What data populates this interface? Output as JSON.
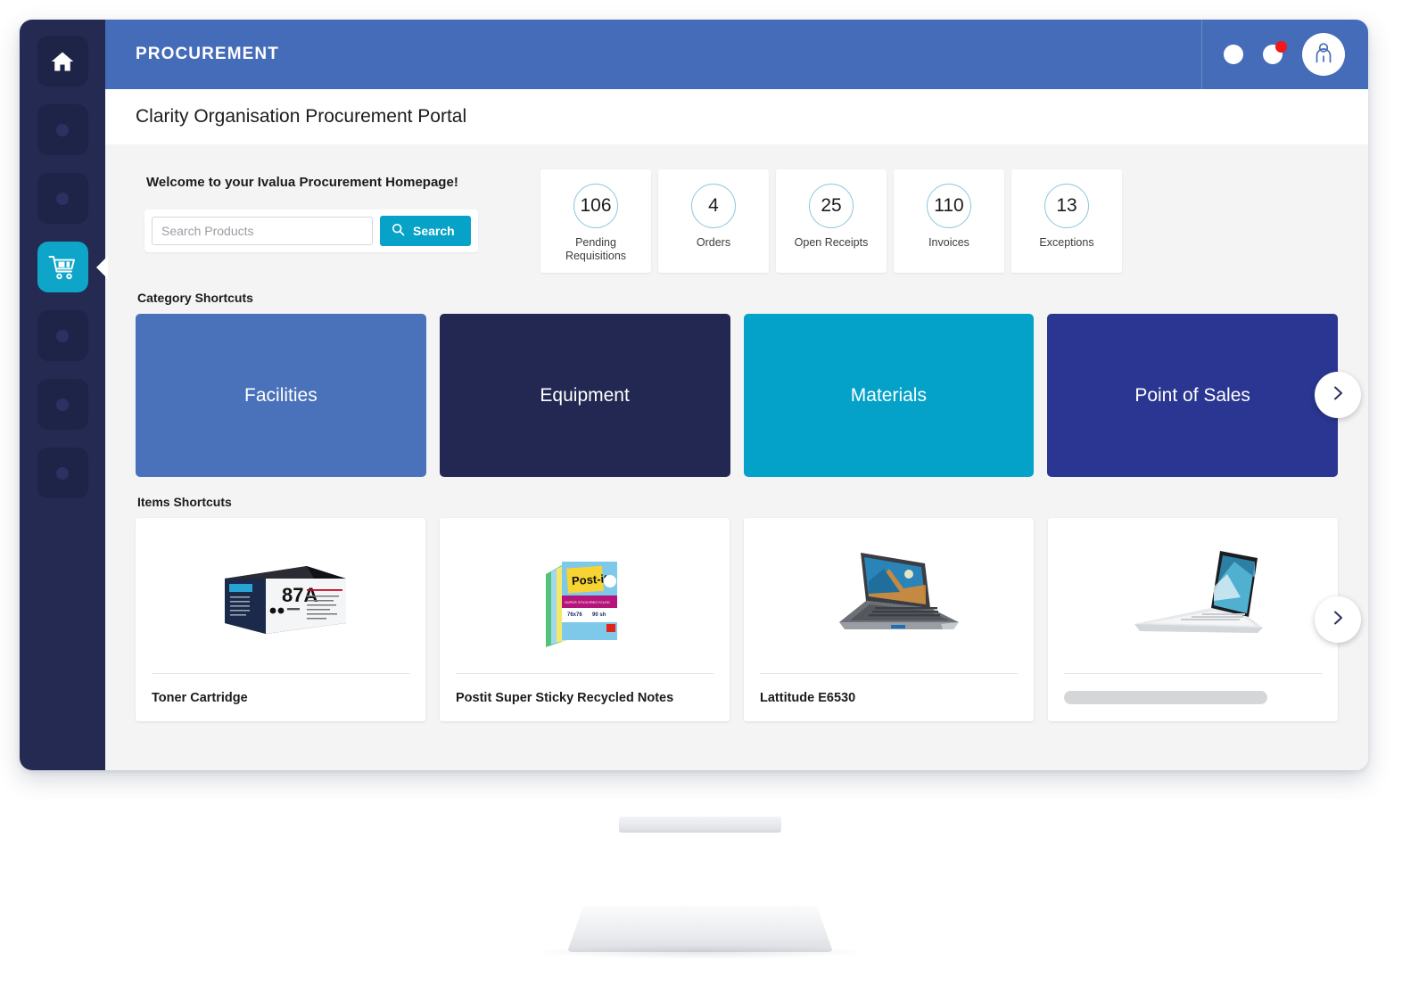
{
  "app": {
    "topbar_title": "PROCUREMENT",
    "page_title": "Clarity Organisation Procurement Portal",
    "header_color": "#456cb8",
    "sidebar_color": "#242a51",
    "accent_color": "#07a2c8",
    "badge_color": "#f01818"
  },
  "sidebar": {
    "items": [
      {
        "name": "home",
        "icon": "home-icon",
        "active": false
      },
      {
        "name": "nav-2",
        "icon": "dot-icon",
        "active": false
      },
      {
        "name": "nav-3",
        "icon": "dot-icon",
        "active": false
      },
      {
        "name": "shopping-cart",
        "icon": "cart-icon",
        "active": true
      },
      {
        "name": "nav-5",
        "icon": "dot-icon",
        "active": false
      },
      {
        "name": "nav-6",
        "icon": "dot-icon",
        "active": false
      },
      {
        "name": "nav-7",
        "icon": "dot-icon",
        "active": false
      }
    ]
  },
  "topbar": {
    "icons": [
      "circle-icon",
      "notification-icon"
    ],
    "avatar": "user-avatar-icon"
  },
  "welcome": {
    "heading": "Welcome to your Ivalua Procurement Homepage!"
  },
  "search": {
    "placeholder": "Search Products",
    "value": "",
    "button_label": "Search",
    "button_icon": "search-icon"
  },
  "kpis": [
    {
      "value": "106",
      "label": "Pending Requisitions"
    },
    {
      "value": "4",
      "label": "Orders"
    },
    {
      "value": "25",
      "label": "Open Receipts"
    },
    {
      "value": "110",
      "label": "Invoices"
    },
    {
      "value": "13",
      "label": "Exceptions"
    }
  ],
  "categories": {
    "title": "Category Shortcuts",
    "next_icon": "chevron-right-icon",
    "tiles": [
      {
        "label": "Facilities",
        "color": "#4a72ba"
      },
      {
        "label": "Equipment",
        "color": "#222851"
      },
      {
        "label": "Materials",
        "color": "#04a2c8"
      },
      {
        "label": "Point of Sales",
        "color": "#2a3691"
      }
    ]
  },
  "items": {
    "title": "Items Shortcuts",
    "next_icon": "chevron-right-icon",
    "cards": [
      {
        "name": "Toner Cartridge",
        "image": "toner-cartridge-box",
        "loading": false
      },
      {
        "name": "Postit Super Sticky Recycled Notes",
        "image": "postit-notes-pack",
        "loading": false
      },
      {
        "name": "Lattitude E6530",
        "image": "dell-latitude-laptop",
        "loading": false
      },
      {
        "name": "",
        "image": "xps-laptop",
        "loading": true
      }
    ]
  }
}
